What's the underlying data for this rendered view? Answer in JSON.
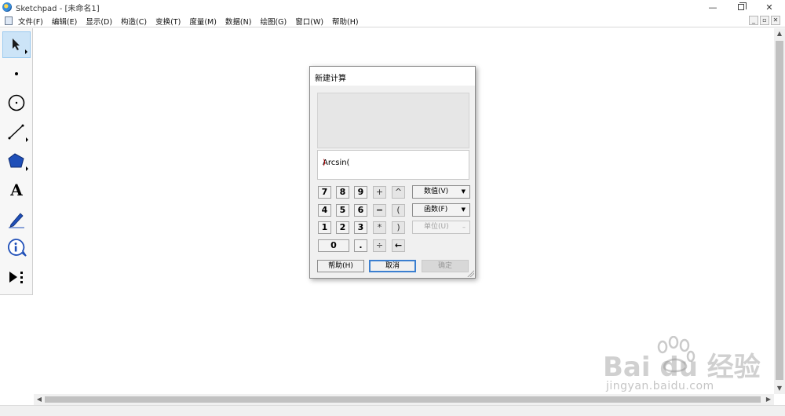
{
  "window": {
    "title": "Sketchpad  - [未命名1]",
    "min_glyph": "—",
    "close_glyph": "✕"
  },
  "menu": {
    "items": [
      "文件(F)",
      "编辑(E)",
      "显示(D)",
      "构造(C)",
      "变换(T)",
      "度量(M)",
      "数据(N)",
      "绘图(G)",
      "窗口(W)",
      "帮助(H)"
    ],
    "mdi_buttons": [
      "_",
      "▫",
      "✕"
    ]
  },
  "toolbox": {
    "tools": [
      "arrow-select-tool",
      "point-tool",
      "compass-tool",
      "straightedge-tool",
      "polygon-tool",
      "text-tool",
      "marker-tool",
      "information-tool",
      "custom-tool"
    ],
    "text_tool_glyph": "A"
  },
  "dialog": {
    "title": "新建计算",
    "expression": "Arcsin(",
    "expression_close": ")",
    "keypad": {
      "row1": [
        "7",
        "8",
        "9",
        "+",
        "^"
      ],
      "row2": [
        "4",
        "5",
        "6",
        "−",
        "("
      ],
      "row3": [
        "1",
        "2",
        "3",
        "*",
        ")"
      ],
      "row4": [
        "0",
        ".",
        "÷",
        "←"
      ]
    },
    "dropdowns": {
      "values": "数值(V)",
      "functions": "函数(F)",
      "units": "单位(U)"
    },
    "buttons": {
      "help": "帮助(H)",
      "cancel": "取消",
      "ok": "确定"
    }
  },
  "scrollbars": {
    "up": "▲",
    "down": "▼",
    "left": "◀",
    "right": "▶"
  },
  "watermark": {
    "brand": "Bai du 经验",
    "url": "jingyan.baidu.com"
  }
}
